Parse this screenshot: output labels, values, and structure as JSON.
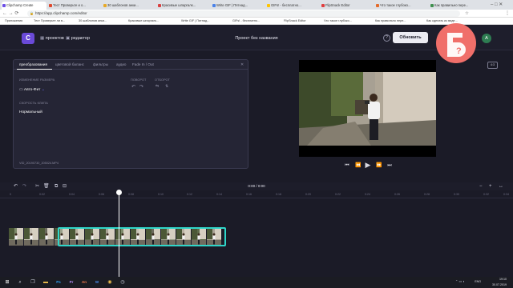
{
  "browser": {
    "tabs": [
      {
        "label": "Clipchamp Create",
        "active": true
      },
      {
        "label": "Тест Проверьте и о..."
      },
      {
        "label": "30 шаблонов анки..."
      },
      {
        "label": "Красивые шпаргалк..."
      },
      {
        "label": "Write GIF | Пятнад..."
      },
      {
        "label": "GIFs! - бесплатно..."
      },
      {
        "label": "FlipSnack Editor"
      },
      {
        "label": "Что такое глубоко..."
      },
      {
        "label": "Как правильно пере..."
      }
    ],
    "url": "https://app.clipchamp.com/editor",
    "bookmarks": [
      "Приложения",
      "Тест Проверьте ли в...",
      "30 шаблонов анки...",
      "Красивые шпаргалк...",
      "Write GIF | Пятнад...",
      "GIFs! - бесплатно...",
      "FlipSnack Editor",
      "Что такое глубоко...",
      "Как правильно пере...",
      "Как сделать из виде..."
    ]
  },
  "header": {
    "logo": "C",
    "nav_projects": "проектов",
    "nav_editor": "редактор",
    "project_title": "Проект без названия",
    "help_icon": "question-icon",
    "export_label": "Обновить",
    "avatar": "A"
  },
  "badge": {
    "label": "Б?",
    "color": "#f06f6a"
  },
  "editor": {
    "tabs": [
      "преобразования",
      "цветовой баланс",
      "фильтры",
      "аудио",
      "Fade In / Out"
    ],
    "resize_label": "ИЗМЕНЕНИЕ РАЗМЕРА",
    "resize_value": "Авто-Фит",
    "rotate_label": "ПОВОРОТ",
    "flip_label": "ОТБОРОТ",
    "speed_label": "СКОРОСТЬ КЛИПА",
    "speed_value": "Нормальный",
    "filename": "VID_20190730_205024.MP4"
  },
  "preview": {
    "ratio": "4:3",
    "controls": [
      "skip-start",
      "rewind",
      "play",
      "forward",
      "skip-end"
    ]
  },
  "timeline": {
    "time": "0:00 / 0:00",
    "ticks": [
      "0",
      "0:02",
      "0:04",
      "0:06",
      "0:08",
      "0:10",
      "0:12",
      "0:14",
      "0:16",
      "0:18",
      "0:20",
      "0:22",
      "0:24",
      "0:26",
      "0:28",
      "0:30",
      "0:32",
      "0:34"
    ],
    "tools": [
      "undo",
      "redo",
      "cut",
      "delete",
      "copy",
      "lock"
    ],
    "zoom": [
      "−",
      "+",
      "↔"
    ]
  },
  "taskbar": {
    "time": "19:10",
    "date": "30.07.2019",
    "lang": "ENG",
    "apps": [
      "windows",
      "search",
      "taskview",
      "explorer",
      "ps",
      "pr",
      "an",
      "word",
      "chrome",
      "clock"
    ]
  },
  "colors": {
    "accent": "#6a4ad8",
    "selection": "#2fd6c9",
    "background": "#1b1b27",
    "panel": "#252535"
  }
}
